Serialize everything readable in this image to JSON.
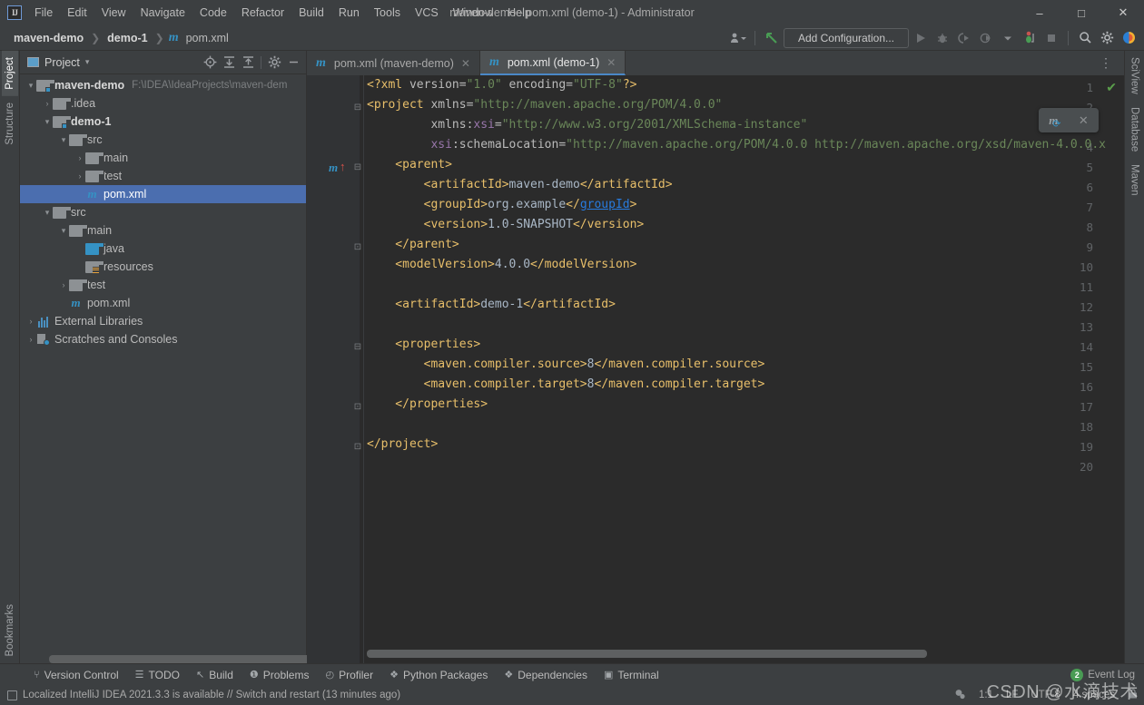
{
  "window": {
    "title": "maven-demo - pom.xml (demo-1) - Administrator",
    "logo": "IJ",
    "minimize": "–",
    "maximize": "□",
    "close": "✕"
  },
  "menu": [
    {
      "label": "File"
    },
    {
      "label": "Edit"
    },
    {
      "label": "View"
    },
    {
      "label": "Navigate"
    },
    {
      "label": "Code"
    },
    {
      "label": "Refactor"
    },
    {
      "label": "Build"
    },
    {
      "label": "Run"
    },
    {
      "label": "Tools"
    },
    {
      "label": "VCS"
    },
    {
      "label": "Window"
    },
    {
      "label": "Help"
    }
  ],
  "breadcrumb": {
    "items": [
      "maven-demo",
      "demo-1",
      "pom.xml"
    ],
    "separator": "❯",
    "file_icon": "m"
  },
  "toolbar": {
    "run_config_label": "Add Configuration...",
    "icons": [
      {
        "name": "user-dropdown-icon",
        "glyph": "☰"
      },
      {
        "name": "update-project-icon",
        "glyph": "↖"
      },
      {
        "name": "run-icon",
        "glyph": "▶"
      },
      {
        "name": "debug-icon",
        "glyph": "🐞"
      },
      {
        "name": "run-with-coverage-icon",
        "glyph": "▶"
      },
      {
        "name": "profiler-icon",
        "glyph": "◴"
      },
      {
        "name": "dropdown-icon",
        "glyph": "▾"
      },
      {
        "name": "stop-icon",
        "glyph": "■"
      },
      {
        "name": "search-everywhere-icon",
        "glyph": "🔍"
      },
      {
        "name": "settings-gear-icon",
        "glyph": "⚙"
      },
      {
        "name": "ide-assistant-icon",
        "glyph": "◗"
      }
    ]
  },
  "left_stripe": [
    {
      "label": "Project",
      "active": true
    },
    {
      "label": "Structure",
      "active": false
    }
  ],
  "left_stripe_bottom": [
    {
      "label": "Bookmarks",
      "active": false
    }
  ],
  "right_stripe": [
    {
      "label": "SciView"
    },
    {
      "label": "Database"
    },
    {
      "label": "Maven"
    }
  ],
  "project_panel": {
    "title": "Project",
    "caret": "▾",
    "tools": [
      {
        "name": "select-opened-file-icon",
        "glyph": "⊕"
      },
      {
        "name": "expand-all-icon",
        "glyph": "⤓"
      },
      {
        "name": "collapse-all-icon",
        "glyph": "⤒"
      },
      {
        "name": "options-gear-icon",
        "glyph": "⚙"
      },
      {
        "name": "hide-panel-icon",
        "glyph": "—"
      }
    ],
    "tree": [
      {
        "indent": 0,
        "arrow": "▾",
        "icon": "folder-module",
        "label": "maven-demo",
        "bold": true,
        "path": "F:\\IDEA\\IdeaProjects\\maven-dem",
        "selected": false
      },
      {
        "indent": 1,
        "arrow": "›",
        "icon": "folder",
        "label": ".idea",
        "bold": false,
        "path": "",
        "selected": false
      },
      {
        "indent": 1,
        "arrow": "▾",
        "icon": "folder-module",
        "label": "demo-1",
        "bold": true,
        "path": "",
        "selected": false
      },
      {
        "indent": 2,
        "arrow": "▾",
        "icon": "folder",
        "label": "src",
        "bold": false,
        "path": "",
        "selected": false
      },
      {
        "indent": 3,
        "arrow": "›",
        "icon": "folder",
        "label": "main",
        "bold": false,
        "path": "",
        "selected": false
      },
      {
        "indent": 3,
        "arrow": "›",
        "icon": "folder",
        "label": "test",
        "bold": false,
        "path": "",
        "selected": false
      },
      {
        "indent": 3,
        "arrow": "",
        "icon": "maven-file",
        "label": "pom.xml",
        "bold": false,
        "path": "",
        "selected": true
      },
      {
        "indent": 1,
        "arrow": "▾",
        "icon": "folder",
        "label": "src",
        "bold": false,
        "path": "",
        "selected": false
      },
      {
        "indent": 2,
        "arrow": "▾",
        "icon": "folder",
        "label": "main",
        "bold": false,
        "path": "",
        "selected": false
      },
      {
        "indent": 3,
        "arrow": "",
        "icon": "folder-source",
        "label": "java",
        "bold": false,
        "path": "",
        "selected": false
      },
      {
        "indent": 3,
        "arrow": "",
        "icon": "folder-resources",
        "label": "resources",
        "bold": false,
        "path": "",
        "selected": false
      },
      {
        "indent": 2,
        "arrow": "›",
        "icon": "folder",
        "label": "test",
        "bold": false,
        "path": "",
        "selected": false
      },
      {
        "indent": 2,
        "arrow": "",
        "icon": "maven-file",
        "label": "pom.xml",
        "bold": false,
        "path": "",
        "selected": false
      },
      {
        "indent": 0,
        "arrow": "›",
        "icon": "libraries",
        "label": "External Libraries",
        "bold": false,
        "path": "",
        "selected": false
      },
      {
        "indent": 0,
        "arrow": "›",
        "icon": "scratches",
        "label": "Scratches and Consoles",
        "bold": false,
        "path": "",
        "selected": false
      }
    ]
  },
  "editor": {
    "tabs": [
      {
        "label": "pom.xml (maven-demo)",
        "icon": "m",
        "active": false,
        "close": "✕"
      },
      {
        "label": "pom.xml (demo-1)",
        "icon": "m",
        "active": true,
        "close": "✕"
      }
    ],
    "tab_overflow_icon": "⋮",
    "inspection_status": "✔",
    "maven_popup": {
      "icon": "m",
      "reload_glyph": "⟳",
      "close": "✕"
    },
    "gutter_marker": {
      "line": 5,
      "icon": "m",
      "arrow": "↑"
    },
    "total_lines": 20,
    "lines": [
      {
        "n": 1,
        "fold": "",
        "segments": [
          {
            "t": "<?xml ",
            "c": "pi"
          },
          {
            "t": "version=",
            "c": "attr"
          },
          {
            "t": "\"1.0\"",
            "c": "str"
          },
          {
            "t": " encoding=",
            "c": "attr"
          },
          {
            "t": "\"UTF-8\"",
            "c": "str"
          },
          {
            "t": "?>",
            "c": "pi"
          }
        ]
      },
      {
        "n": 2,
        "fold": "⊟",
        "segments": [
          {
            "t": "<project ",
            "c": "tag"
          },
          {
            "t": "xmlns=",
            "c": "attr"
          },
          {
            "t": "\"http://maven.apache.org/POM/4.0.0\"",
            "c": "str"
          }
        ]
      },
      {
        "n": 3,
        "fold": "",
        "segments": [
          {
            "t": "         xmlns:",
            "c": "attr"
          },
          {
            "t": "xsi",
            "c": "ns"
          },
          {
            "t": "=",
            "c": "attr"
          },
          {
            "t": "\"http://www.w3.org/2001/XMLSchema-instance\"",
            "c": "str"
          }
        ]
      },
      {
        "n": 4,
        "fold": "",
        "segments": [
          {
            "t": "         ",
            "c": "attr"
          },
          {
            "t": "xsi",
            "c": "ns"
          },
          {
            "t": ":schemaLocation=",
            "c": "attr"
          },
          {
            "t": "\"http://maven.apache.org/POM/4.0.0 http://maven.apache.org/xsd/maven-4.0.0.x",
            "c": "str"
          }
        ]
      },
      {
        "n": 5,
        "fold": "⊟",
        "segments": [
          {
            "t": "    <parent>",
            "c": "tag"
          }
        ]
      },
      {
        "n": 6,
        "fold": "",
        "segments": [
          {
            "t": "        <artifactId>",
            "c": "tag"
          },
          {
            "t": "maven-demo",
            "c": "txt"
          },
          {
            "t": "</artifactId>",
            "c": "tag"
          }
        ]
      },
      {
        "n": 7,
        "fold": "",
        "segments": [
          {
            "t": "        <groupId>",
            "c": "tag"
          },
          {
            "t": "org.example",
            "c": "txt"
          },
          {
            "t": "</",
            "c": "tag"
          },
          {
            "t": "groupId",
            "c": "glnk"
          },
          {
            "t": ">",
            "c": "tag"
          }
        ]
      },
      {
        "n": 8,
        "fold": "",
        "segments": [
          {
            "t": "        <version>",
            "c": "tag"
          },
          {
            "t": "1.0-SNAPSHOT",
            "c": "txt"
          },
          {
            "t": "</version>",
            "c": "tag"
          }
        ]
      },
      {
        "n": 9,
        "fold": "⊡",
        "segments": [
          {
            "t": "    </parent>",
            "c": "tag"
          }
        ]
      },
      {
        "n": 10,
        "fold": "",
        "segments": [
          {
            "t": "    <modelVersion>",
            "c": "tag"
          },
          {
            "t": "4.0.0",
            "c": "txt"
          },
          {
            "t": "</modelVersion>",
            "c": "tag"
          }
        ]
      },
      {
        "n": 11,
        "fold": "",
        "segments": [
          {
            "t": "",
            "c": "txt"
          }
        ]
      },
      {
        "n": 12,
        "fold": "",
        "segments": [
          {
            "t": "    <artifactId>",
            "c": "tag"
          },
          {
            "t": "demo-1",
            "c": "txt"
          },
          {
            "t": "</artifactId>",
            "c": "tag"
          }
        ]
      },
      {
        "n": 13,
        "fold": "",
        "segments": [
          {
            "t": "",
            "c": "txt"
          }
        ]
      },
      {
        "n": 14,
        "fold": "⊟",
        "segments": [
          {
            "t": "    <properties>",
            "c": "tag"
          }
        ]
      },
      {
        "n": 15,
        "fold": "",
        "segments": [
          {
            "t": "        <maven.compiler.source>",
            "c": "tag"
          },
          {
            "t": "8",
            "c": "txt"
          },
          {
            "t": "</maven.compiler.source>",
            "c": "tag"
          }
        ]
      },
      {
        "n": 16,
        "fold": "",
        "segments": [
          {
            "t": "        <maven.compiler.target>",
            "c": "tag"
          },
          {
            "t": "8",
            "c": "txt"
          },
          {
            "t": "</maven.compiler.target>",
            "c": "tag"
          }
        ]
      },
      {
        "n": 17,
        "fold": "⊡",
        "segments": [
          {
            "t": "    </properties>",
            "c": "tag"
          }
        ]
      },
      {
        "n": 18,
        "fold": "",
        "segments": [
          {
            "t": "",
            "c": "txt"
          }
        ]
      },
      {
        "n": 19,
        "fold": "⊡",
        "segments": [
          {
            "t": "</project>",
            "c": "tag"
          }
        ]
      },
      {
        "n": 20,
        "fold": "",
        "segments": [
          {
            "t": "",
            "c": "txt"
          }
        ]
      }
    ]
  },
  "bottom_bar": [
    {
      "label": "Version Control",
      "icon": "⑂"
    },
    {
      "label": "TODO",
      "icon": "☰"
    },
    {
      "label": "Build",
      "icon": "↖"
    },
    {
      "label": "Problems",
      "icon": "❶"
    },
    {
      "label": "Profiler",
      "icon": "◴"
    },
    {
      "label": "Python Packages",
      "icon": "❖"
    },
    {
      "label": "Dependencies",
      "icon": "❖"
    },
    {
      "label": "Terminal",
      "icon": "▣"
    }
  ],
  "status_bar": {
    "message": "Localized IntelliJ IDEA 2021.3.3 is available // Switch and restart (13 minutes ago)",
    "caret_position": "1:1",
    "line_separator": "LF",
    "encoding": "UTF-8",
    "indent": "4 spaces",
    "event_log_label": "Event Log",
    "event_log_count": "2",
    "watermark": "CSDN @水滴技术"
  }
}
